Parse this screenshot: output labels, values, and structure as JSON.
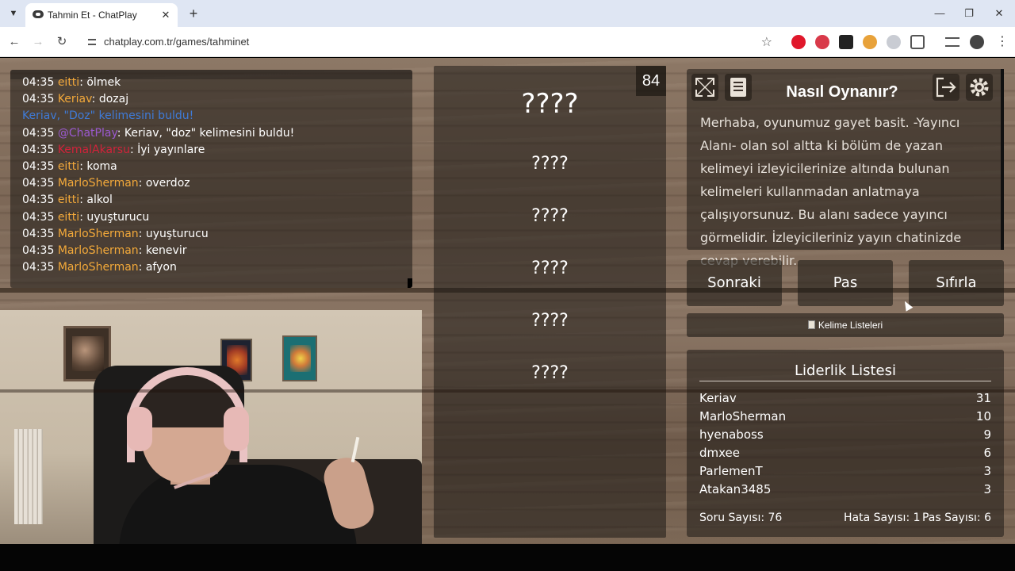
{
  "browser": {
    "tab_title": "Tahmin Et - ChatPlay",
    "url": "chatplay.com.tr/games/tahminet"
  },
  "chat": {
    "messages": [
      {
        "time": "04:35",
        "user": "eitti",
        "user_color": "#f3a93a",
        "text": "ölmek"
      },
      {
        "time": "04:35",
        "user": "Keriav",
        "user_color": "#f3a93a",
        "text": "dozaj"
      },
      {
        "system": "Keriav, \"Doz\" kelimesini buldu!",
        "color": "#3f7bd8"
      },
      {
        "time": "04:35",
        "user": "@ChatPlay",
        "user_color": "#9b59d0",
        "text": "Keriav, \"doz\" kelimesini buldu!"
      },
      {
        "time": "04:35",
        "user": "KemalAkarsu",
        "user_color": "#d0233a",
        "text": "İyi yayınlare"
      },
      {
        "time": "04:35",
        "user": "eitti",
        "user_color": "#f3a93a",
        "text": "koma"
      },
      {
        "time": "04:35",
        "user": "MarloSherman",
        "user_color": "#f3a93a",
        "text": "overdoz"
      },
      {
        "time": "04:35",
        "user": "eitti",
        "user_color": "#f3a93a",
        "text": "alkol"
      },
      {
        "time": "04:35",
        "user": "eitti",
        "user_color": "#f3a93a",
        "text": "uyuşturucu"
      },
      {
        "time": "04:35",
        "user": "MarloSherman",
        "user_color": "#f3a93a",
        "text": "uyuşturucu"
      },
      {
        "time": "04:35",
        "user": "MarloSherman",
        "user_color": "#f3a93a",
        "text": "kenevir"
      },
      {
        "time": "04:35",
        "user": "MarloSherman",
        "user_color": "#f3a93a",
        "text": "afyon"
      }
    ]
  },
  "game": {
    "counter": "84",
    "main_word": "????",
    "forbidden_words": [
      "????",
      "????",
      "????",
      "????",
      "????"
    ]
  },
  "howto": {
    "title": "Nasıl Oynanır?",
    "text": "Merhaba, oyunumuz gayet basit. -Yayıncı Alanı- olan sol altta ki bölüm de yazan kelimeyi izleyicilerinize altında bulunan kelimeleri kullanmadan anlatmaya çalışıyorsunuz. Bu alanı sadece yayıncı görmelidir. İzleyicileriniz yayın chatinizde cevap verebilir."
  },
  "buttons": {
    "next": "Sonraki",
    "pass": "Pas",
    "reset": "Sıfırla",
    "word_lists": "Kelime Listeleri"
  },
  "leaderboard": {
    "title": "Liderlik Listesi",
    "rows": [
      {
        "name": "Keriav",
        "score": "31"
      },
      {
        "name": "MarloSherman",
        "score": "10"
      },
      {
        "name": "hyenaboss",
        "score": "9"
      },
      {
        "name": "dmxee",
        "score": "6"
      },
      {
        "name": "ParlemenT",
        "score": "3"
      },
      {
        "name": "Atakan3485",
        "score": "3"
      }
    ],
    "questions": "Soru Sayısı: 76",
    "errors": "Hata Sayısı: 1",
    "passes": "Pas Sayısı: 6"
  }
}
